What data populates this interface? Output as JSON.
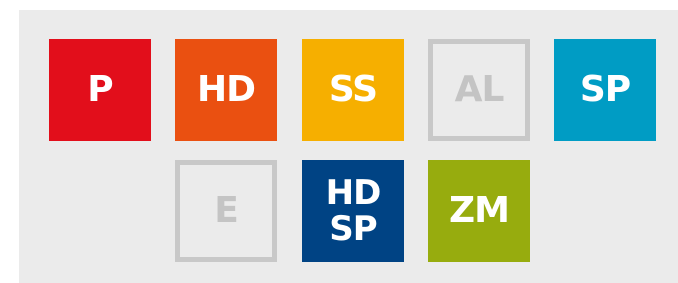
{
  "tiles": [
    {
      "id": "p",
      "lines": [
        "P"
      ],
      "style": "filled",
      "color": "#e20e1b"
    },
    {
      "id": "hd",
      "lines": [
        "HD"
      ],
      "style": "filled",
      "color": "#ea5011"
    },
    {
      "id": "ss",
      "lines": [
        "SS"
      ],
      "style": "filled",
      "color": "#f6af00"
    },
    {
      "id": "al",
      "lines": [
        "AL"
      ],
      "style": "outline",
      "color": "#c8c8c8"
    },
    {
      "id": "sp",
      "lines": [
        "SP"
      ],
      "style": "filled",
      "color": "#009cc4"
    },
    {
      "id": "e",
      "lines": [
        "E"
      ],
      "style": "outline",
      "color": "#c8c8c8"
    },
    {
      "id": "hdsp",
      "lines": [
        "HD",
        "SP"
      ],
      "style": "filled",
      "color": "#004384"
    },
    {
      "id": "zm",
      "lines": [
        "ZM"
      ],
      "style": "filled",
      "color": "#97ac0e"
    }
  ]
}
